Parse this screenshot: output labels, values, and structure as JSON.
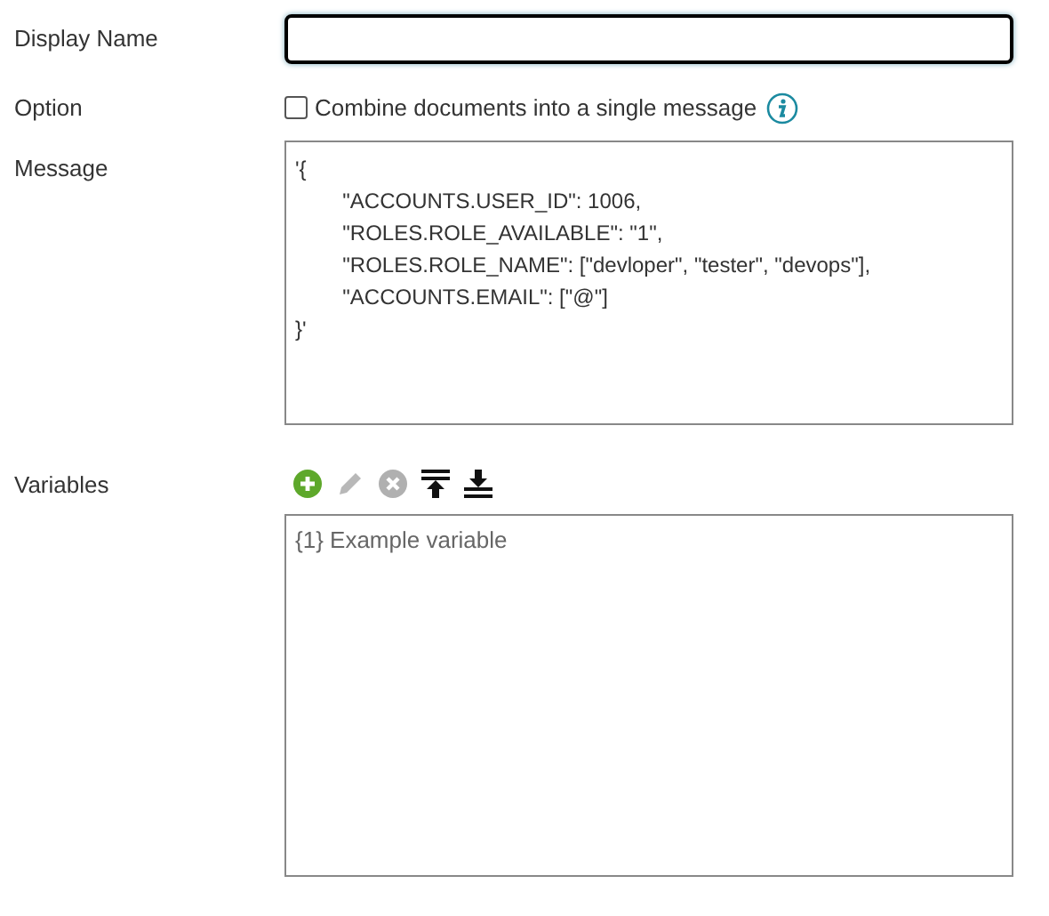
{
  "display_name": {
    "label": "Display Name",
    "focused": true
  },
  "option": {
    "label": "Option",
    "checkbox": {
      "label": "Combine documents into a single message",
      "checked": false
    }
  },
  "message": {
    "label": "Message",
    "value": "'{\n\t\"ACCOUNTS.USER_ID\": 1006,\n\t\"ROLES.ROLE_AVAILABLE\": \"1\",\n\t\"ROLES.ROLE_NAME\": [\"devloper\", \"tester\", \"devops\"],\n\t\"ACCOUNTS.EMAIL\": [\"@\"]\n}'"
  },
  "variables": {
    "label": "Variables",
    "toolbar": [
      {
        "kind": "add",
        "disabled": false
      },
      {
        "kind": "edit",
        "disabled": true
      },
      {
        "kind": "delete",
        "disabled": true
      },
      {
        "kind": "move_top",
        "disabled": false
      },
      {
        "kind": "move_bottom",
        "disabled": false
      }
    ],
    "items": [
      {
        "text": "{1} Example variable",
        "selected": false
      }
    ]
  }
}
